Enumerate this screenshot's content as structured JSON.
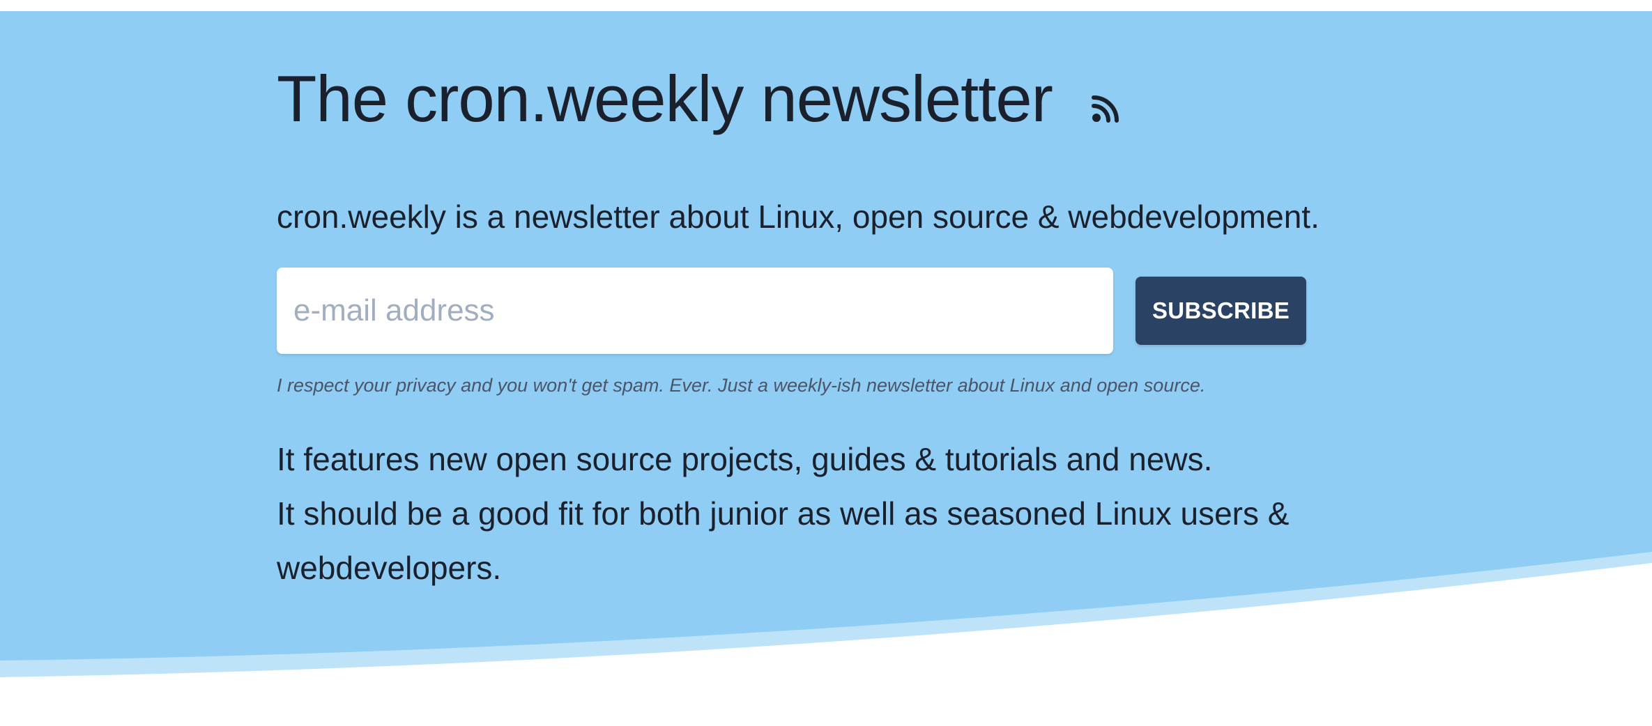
{
  "hero": {
    "title": "The cron.weekly newsletter",
    "intro": "cron.weekly is a newsletter about Linux, open source & webdevelopment.",
    "email_placeholder": "e-mail address",
    "subscribe_label": "SUBSCRIBE",
    "privacy_note": "I respect your privacy and you won't get spam. Ever. Just a weekly-ish newsletter about Linux and open source.",
    "features_line_1": "It features new open source projects, guides & tutorials and news.",
    "features_line_2": "It should be a good fit for both junior as well as seasoned Linux users & webdevelopers."
  },
  "icons": {
    "rss": "rss-icon"
  },
  "colors": {
    "hero_background": "#90CDF4",
    "wave_accent": "#BEE3F8",
    "button_background": "#2A4365",
    "text": "#1A202C"
  }
}
